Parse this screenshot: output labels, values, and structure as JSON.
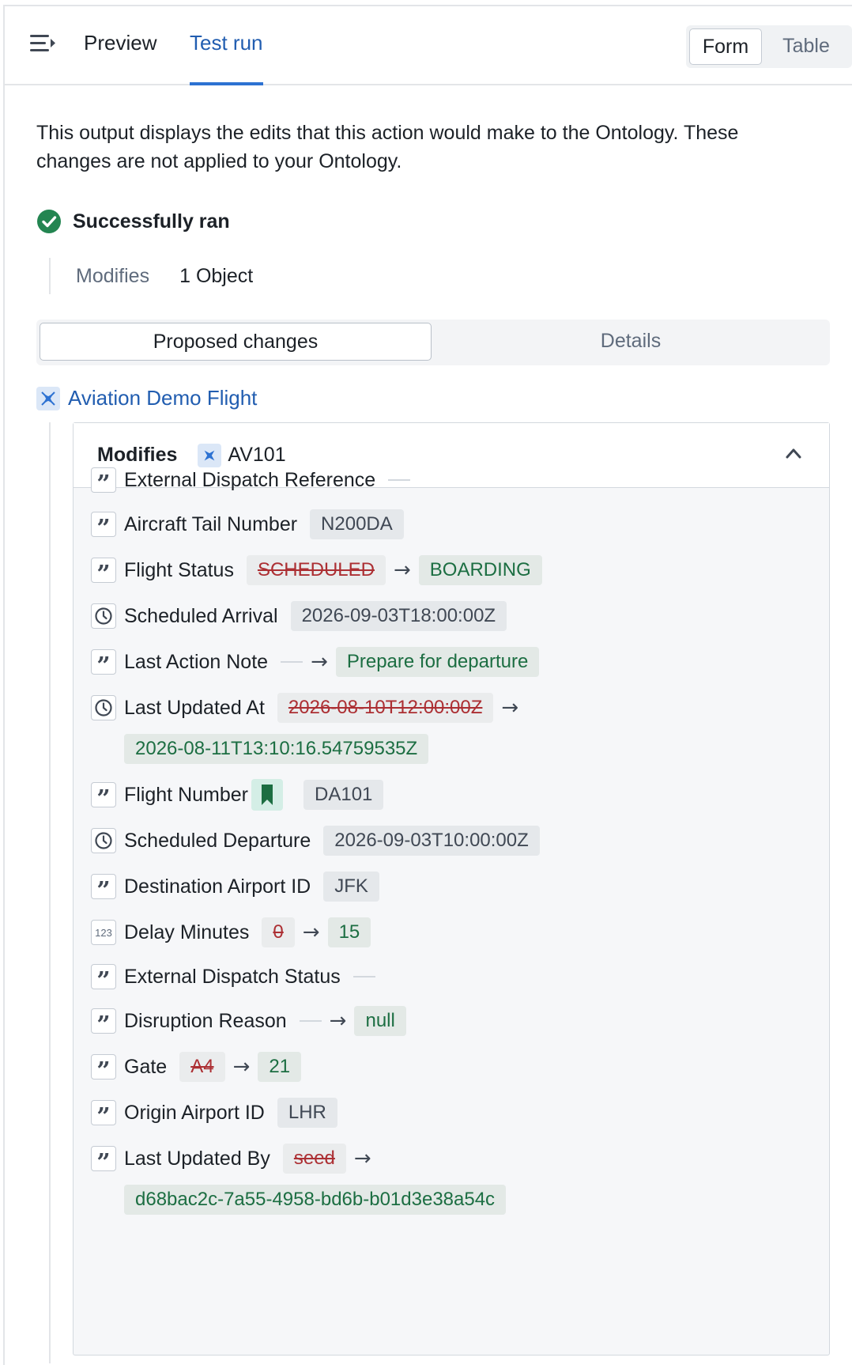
{
  "header": {
    "tabs": [
      "Preview",
      "Test run"
    ],
    "view_options": [
      "Form",
      "Table"
    ]
  },
  "description": "This output displays the edits that this action would make to the Ontology. These changes are not applied to your Ontology.",
  "status": "Successfully ran",
  "summary": {
    "label": "Modifies",
    "value": "1 Object"
  },
  "subtabs": [
    "Proposed changes",
    "Details"
  ],
  "object_type": "Aviation Demo Flight",
  "card": {
    "label": "Modifies",
    "object": "AV101",
    "properties": [
      {
        "name": "External Dispatch Reference",
        "type": "string"
      },
      {
        "name": "Aircraft Tail Number",
        "type": "string",
        "value": "N200DA"
      },
      {
        "name": "Flight Status",
        "type": "string",
        "old": "SCHEDULED",
        "new": "BOARDING"
      },
      {
        "name": "Scheduled Arrival",
        "type": "timestamp",
        "value": "2026-09-03T18:00:00Z"
      },
      {
        "name": "Last Action Note",
        "type": "string",
        "new": "Prepare for departure"
      },
      {
        "name": "Last Updated At",
        "type": "timestamp",
        "old": "2026-08-10T12:00:00Z",
        "new": "2026-08-11T13:10:16.54759535Z"
      },
      {
        "name": "Flight Number",
        "type": "string",
        "value": "DA101"
      },
      {
        "name": "Scheduled Departure",
        "type": "timestamp",
        "value": "2026-09-03T10:00:00Z"
      },
      {
        "name": "Destination Airport ID",
        "type": "string",
        "value": "JFK"
      },
      {
        "name": "Delay Minutes",
        "type": "integer",
        "old": "0",
        "new": "15"
      },
      {
        "name": "External Dispatch Status",
        "type": "string"
      },
      {
        "name": "Disruption Reason",
        "type": "string",
        "new": "null"
      },
      {
        "name": "Gate",
        "type": "string",
        "old": "A4",
        "new": "21"
      },
      {
        "name": "Origin Airport ID",
        "type": "string",
        "value": "LHR"
      },
      {
        "name": "Last Updated By",
        "type": "string",
        "old": "seed",
        "new": "d68bac2c-7a55-4958-bd6b-b01d3e38a54c"
      }
    ]
  },
  "type_icon_text": "123",
  "colors": {
    "accent": "#2d72d2",
    "link": "#215db0",
    "success": "#238551",
    "removed": "#ac2f33",
    "added": "#1c6e42"
  }
}
